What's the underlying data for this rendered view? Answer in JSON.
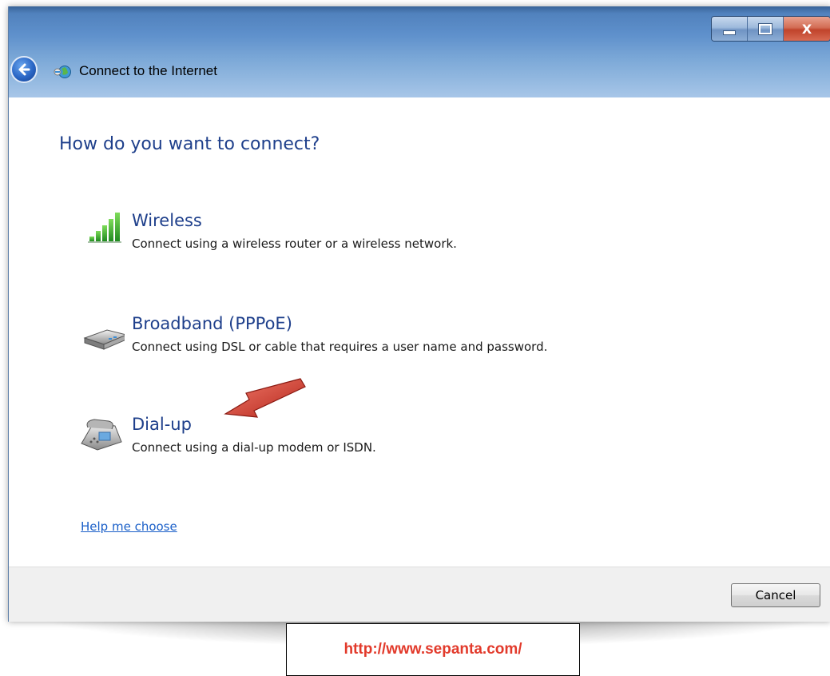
{
  "window": {
    "title": "Connect to the Internet",
    "close_label": "X"
  },
  "main": {
    "heading": "How do you want to connect?",
    "options": [
      {
        "icon": "wireless-signal-icon",
        "title": "Wireless",
        "description": "Connect using a wireless router or a wireless network."
      },
      {
        "icon": "broadband-modem-icon",
        "title": "Broadband (PPPoE)",
        "description": "Connect using DSL or cable that requires a user name and password."
      },
      {
        "icon": "dialup-phone-icon",
        "title": "Dial-up",
        "description": "Connect using a dial-up modem or ISDN."
      }
    ],
    "help_link": "Help me choose"
  },
  "footer": {
    "cancel_label": "Cancel"
  },
  "watermark": {
    "url": "http://www.sepanta.com/"
  },
  "annotation": {
    "arrow_color": "#d23a2a"
  }
}
